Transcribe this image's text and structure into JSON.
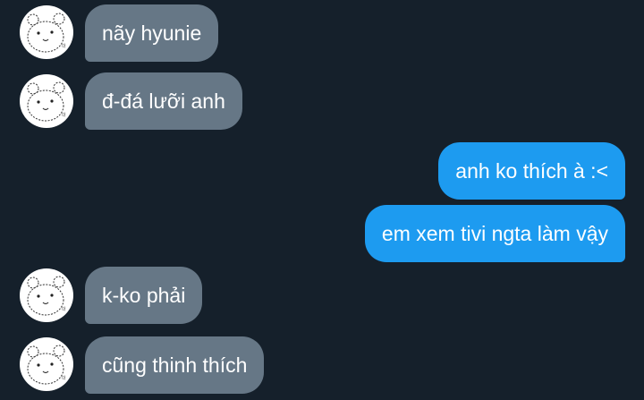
{
  "conversation": {
    "messages": [
      {
        "direction": "incoming",
        "text": "nãy hyunie",
        "has_avatar": true
      },
      {
        "direction": "incoming",
        "text": "đ-đá lưỡi anh",
        "has_avatar": true
      },
      {
        "direction": "outgoing",
        "text": "anh ko thích à :<",
        "has_avatar": false
      },
      {
        "direction": "outgoing",
        "text": "em xem tivi ngta làm vậy",
        "has_avatar": false
      },
      {
        "direction": "incoming",
        "text": "k-ko phải",
        "has_avatar": true
      },
      {
        "direction": "incoming",
        "text": "cũng thinh thích",
        "has_avatar": true
      }
    ],
    "avatar_icon": "bear-doodle-icon"
  },
  "colors": {
    "background": "#15202b",
    "incoming_bubble": "#667786",
    "outgoing_bubble": "#1d9bf0",
    "text": "#ffffff",
    "avatar_bg": "#ffffff"
  }
}
